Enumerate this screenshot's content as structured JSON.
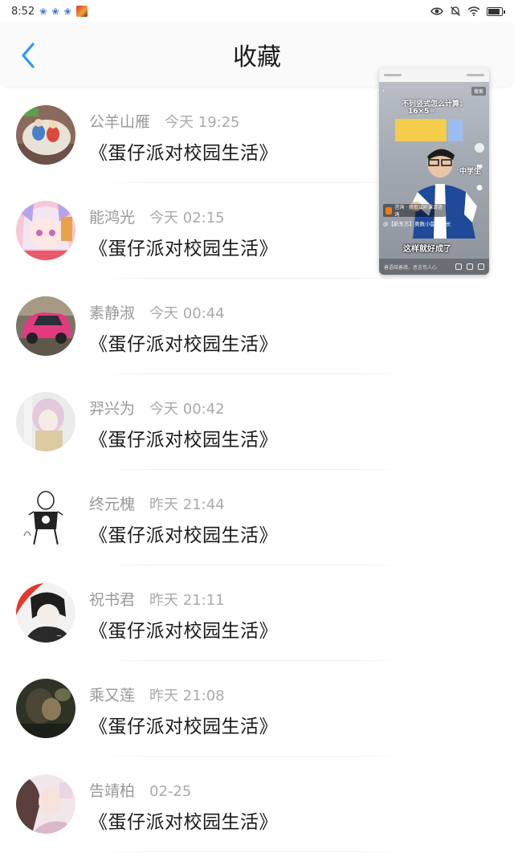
{
  "status_bar": {
    "time": "8:52"
  },
  "header": {
    "title": "收藏"
  },
  "favorites": [
    {
      "name": "公羊山雁",
      "time": "今天 19:25",
      "title": "《蛋仔派对校园生活》"
    },
    {
      "name": "能鸿光",
      "time": "今天 02:15",
      "title": "《蛋仔派对校园生活》"
    },
    {
      "name": "素静淑",
      "time": "今天 00:44",
      "title": "《蛋仔派对校园生活》"
    },
    {
      "name": "羿兴为",
      "time": "今天 00:42",
      "title": "《蛋仔派对校园生活》"
    },
    {
      "name": "终元槐",
      "time": "昨天 21:44",
      "title": "《蛋仔派对校园生活》"
    },
    {
      "name": "祝书君",
      "time": "昨天 21:11",
      "title": "《蛋仔派对校园生活》"
    },
    {
      "name": "乘又莲",
      "time": "昨天 21:08",
      "title": "《蛋仔派对校园生活》"
    },
    {
      "name": "告靖柏",
      "time": "02-25",
      "title": "《蛋仔派对校园生活》"
    }
  ],
  "floating_video": {
    "search_label": "搜索",
    "question": "不列竖式怎么计算：",
    "equation": "16×5=",
    "side_label": "中学生",
    "tag": "咨询 · 获取试听课请咨询",
    "caption": "@【新东方】奥数小甜瓜成长",
    "subtitle": "这样就好成了",
    "comment_placeholder": "善语结善缘，恶言伤人心"
  },
  "colors": {
    "accent": "#2b9af3",
    "title_text": "#1a1a1a",
    "meta_text": "#999999"
  }
}
